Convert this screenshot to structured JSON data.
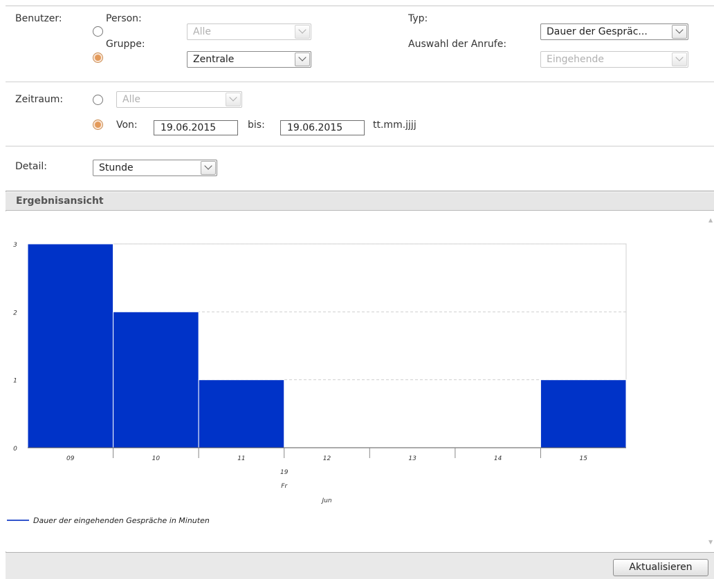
{
  "filters": {
    "benutzer_label": "Benutzer:",
    "person_label": "Person:",
    "person_select": "Alle",
    "gruppe_label": "Gruppe:",
    "gruppe_select": "Zentrale",
    "typ_label": "Typ:",
    "typ_select": "Dauer der Gespräc...",
    "anrufe_label": "Auswahl der Anrufe:",
    "anrufe_select": "Eingehende"
  },
  "zeitraum": {
    "label": "Zeitraum:",
    "alle_select": "Alle",
    "von_label": "Von:",
    "von_value": "19.06.2015",
    "bis_label": "bis:",
    "bis_value": "19.06.2015",
    "format_hint": "tt.mm.jjjj"
  },
  "detail": {
    "label": "Detail:",
    "select": "Stunde"
  },
  "results": {
    "header": "Ergebnisansicht"
  },
  "footer": {
    "refresh_label": "Aktualisieren"
  },
  "colors": {
    "bar": "#0033c8",
    "legend_line": "#3355cc",
    "radio_selected": "#e39a5a"
  },
  "chart_data": {
    "type": "bar",
    "categories": [
      "09",
      "10",
      "11",
      "12",
      "13",
      "14",
      "15"
    ],
    "values": [
      3,
      2,
      1,
      0,
      0,
      0,
      1
    ],
    "ylim": [
      0,
      3
    ],
    "yticks": [
      "0",
      "1",
      "2",
      "3"
    ],
    "date_labels": [
      "19",
      "Fr",
      "Jun"
    ],
    "grid": true,
    "series": [
      {
        "name": "Dauer der eingehenden Gespräche in Minuten",
        "values": [
          3,
          2,
          1,
          0,
          0,
          0,
          1
        ]
      }
    ],
    "legend_position": "bottom-left"
  }
}
